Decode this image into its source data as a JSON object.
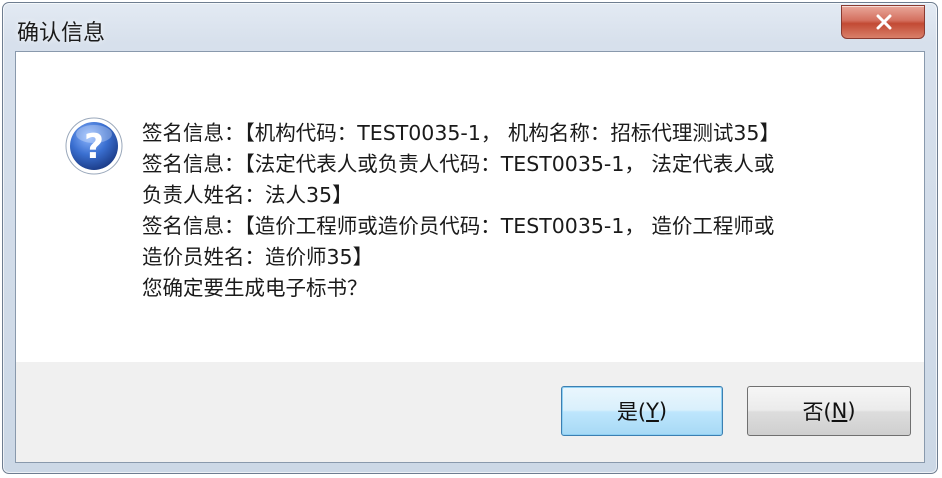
{
  "dialog": {
    "title": "确认信息",
    "close_icon": "close-x-icon",
    "icon": "question-icon",
    "messages": [
      "签名信息：【机构代码：TEST0035-1， 机构名称：招标代理测试35】",
      "签名信息：【法定代表人或负责人代码：TEST0035-1， 法定代表人或",
      "负责人姓名：法人35】",
      "签名信息：【造价工程师或造价员代码：TEST0035-1， 造价工程师或",
      "造价员姓名：造价师35】",
      "您确定要生成电子标书？"
    ],
    "buttons": {
      "yes": {
        "label": "是(",
        "accel": "Y",
        "close": ")"
      },
      "no": {
        "label": "否(",
        "accel": "N",
        "close": ")"
      }
    }
  },
  "colors": {
    "close_button": "#c24a34",
    "default_button_border": "#3c7fb1",
    "question_icon": "#2c5fb8"
  }
}
